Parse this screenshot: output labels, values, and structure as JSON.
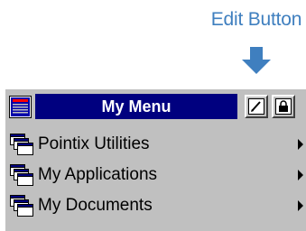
{
  "callout": {
    "label": "Edit Button",
    "color": "#3f7fbf",
    "arrow_icon": "down-arrow-icon"
  },
  "menu": {
    "title": "My Menu",
    "title_icon": "menu-grid-icon",
    "title_bg": "#00007f",
    "buttons": [
      {
        "name": "edit",
        "icon": "pencil-icon"
      },
      {
        "name": "lock",
        "icon": "lock-icon"
      }
    ],
    "items": [
      {
        "label": "Pointix Utilities",
        "icon": "folder-window-icon",
        "has_submenu": true
      },
      {
        "label": "My Applications",
        "icon": "folder-window-icon",
        "has_submenu": true
      },
      {
        "label": "My Documents",
        "icon": "folder-window-icon",
        "has_submenu": true
      }
    ]
  }
}
